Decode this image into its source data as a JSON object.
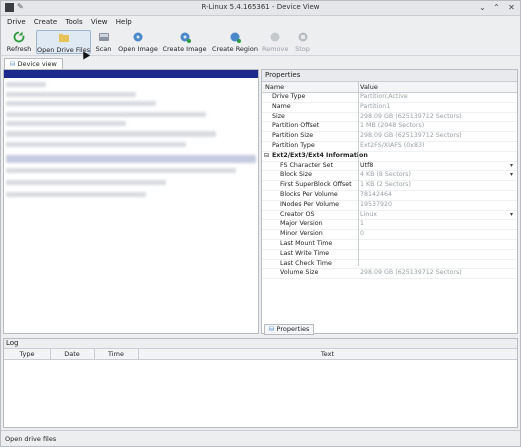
{
  "window": {
    "title": "R-Linux 5.4.165361 - Device View"
  },
  "menu": [
    "Drive",
    "Create",
    "Tools",
    "View",
    "Help"
  ],
  "toolbar": {
    "refresh": "Refresh",
    "open_drive_files": "Open Drive Files",
    "scan": "Scan",
    "open_image": "Open Image",
    "create_image": "Create Image",
    "create_region": "Create Region",
    "remove": "Remove",
    "stop": "Stop"
  },
  "tabs": {
    "device_view": "Device view"
  },
  "properties": {
    "title": "Properties",
    "col_name": "Name",
    "col_value": "Value",
    "rows": [
      {
        "name": "Drive Type",
        "value": "Partition,Active"
      },
      {
        "name": "Name",
        "value": "Partition1"
      },
      {
        "name": "Size",
        "value": "298.09 GB (625139712 Sectors)"
      },
      {
        "name": "Partition Offset",
        "value": "1 MB (2048 Sectors)"
      },
      {
        "name": "Partition Size",
        "value": "298.09 GB (625139712 Sectors)"
      },
      {
        "name": "Partition Type",
        "value": "Ext2FS/XIAFS (0x83)"
      },
      {
        "name": "Ext2/Ext3/Ext4 Information",
        "value": ""
      },
      {
        "name": "FS Character Set",
        "value": "Utf8"
      },
      {
        "name": "Block Size",
        "value": "4 KB (8 Sectors)"
      },
      {
        "name": "First SuperBlock Offset",
        "value": "1 KB (2 Sectors)"
      },
      {
        "name": "Blocks Per Volume",
        "value": "78142464"
      },
      {
        "name": "INodes Per Volume",
        "value": "19537920"
      },
      {
        "name": "Creator OS",
        "value": "Linux"
      },
      {
        "name": "Major Version",
        "value": "1"
      },
      {
        "name": "Minor Version",
        "value": "0"
      },
      {
        "name": "Last Mount Time",
        "value": ""
      },
      {
        "name": "Last Write Time",
        "value": ""
      },
      {
        "name": "Last Check Time",
        "value": ""
      },
      {
        "name": "Volume Size",
        "value": "298.09 GB (625139712 Sectors)"
      }
    ],
    "tab_label": "Properties"
  },
  "log": {
    "title": "Log",
    "columns": [
      "Type",
      "Date",
      "Time",
      "Text"
    ]
  },
  "status": "Open drive files",
  "colors": {
    "selection": "#1c2a8c",
    "refresh_icon": "#2e9b3e",
    "folder_icon": "#e8c357"
  }
}
